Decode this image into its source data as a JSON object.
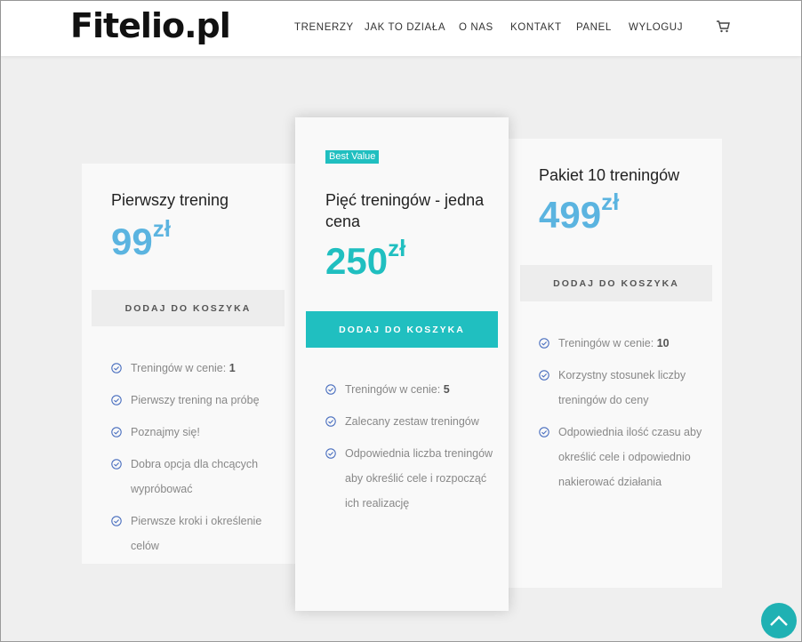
{
  "header": {
    "logo": "Fitelio.pl",
    "nav": [
      {
        "label": "TRENERZY"
      },
      {
        "label": "JAK TO DZIAŁA"
      },
      {
        "label": "O NAS"
      },
      {
        "label": "KONTAKT"
      },
      {
        "label": "PANEL"
      },
      {
        "label": "WYLOGUJ"
      }
    ],
    "cart_icon": "cart-icon"
  },
  "colors": {
    "accent": "#20bfc0",
    "price_blue": "#5bb4e0",
    "background": "#efefef"
  },
  "plans": [
    {
      "title": "Pierwszy trening",
      "price": "99",
      "currency": "zł",
      "button": "DODAJ DO KOSZYKA",
      "features": [
        {
          "text": "Treningów w cenie: ",
          "bold": "1"
        },
        {
          "text": "Pierwszy trening na próbę",
          "bold": ""
        },
        {
          "text": "Poznajmy się!",
          "bold": ""
        },
        {
          "text": "Dobra opcja dla chcących wypróbować",
          "bold": ""
        },
        {
          "text": "Pierwsze kroki i określenie celów",
          "bold": ""
        }
      ]
    },
    {
      "badge": "Best Value",
      "title": "Pięć treningów - jedna cena",
      "price": "250",
      "currency": "zł",
      "button": "DODAJ DO KOSZYKA",
      "features": [
        {
          "text": "Treningów w cenie: ",
          "bold": "5"
        },
        {
          "text": "Zalecany zestaw treningów",
          "bold": ""
        },
        {
          "text": "Odpowiednia liczba treningów aby określić cele i rozpocząć ich realizację",
          "bold": ""
        }
      ]
    },
    {
      "title": "Pakiet 10 treningów",
      "price": "499",
      "currency": "zł",
      "button": "DODAJ DO KOSZYKA",
      "features": [
        {
          "text": "Treningów w cenie: ",
          "bold": "10"
        },
        {
          "text": "Korzystny stosunek liczby treningów do ceny",
          "bold": ""
        },
        {
          "text": "Odpowiednia ilość czasu aby określić cele i odpowiednio nakierować działania",
          "bold": ""
        }
      ]
    }
  ],
  "scroll_top_icon": "chevron-up-icon"
}
